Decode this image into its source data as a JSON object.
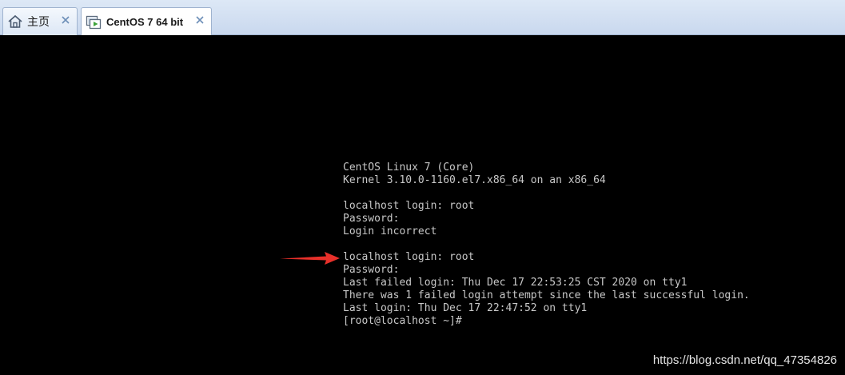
{
  "tabs": [
    {
      "label": "主页",
      "icon": "home-icon",
      "active": false
    },
    {
      "label": "CentOS 7 64 bit",
      "icon": "vm-icon",
      "active": true
    }
  ],
  "close_glyph": "✕",
  "terminal": {
    "lines": [
      "CentOS Linux 7 (Core)",
      "Kernel 3.10.0-1160.el7.x86_64 on an x86_64",
      "",
      "localhost login: root",
      "Password:",
      "Login incorrect",
      "",
      "localhost login: root",
      "Password:",
      "Last failed login: Thu Dec 17 22:53:25 CST 2020 on tty1",
      "There was 1 failed login attempt since the last successful login.",
      "Last login: Thu Dec 17 22:47:52 on tty1",
      "[root@localhost ~]#"
    ]
  },
  "annotation": {
    "icon": "arrow-right-icon",
    "color": "#e8302a"
  },
  "watermark": "https://blog.csdn.net/qq_47354826",
  "colors": {
    "console_bg": "#000000",
    "console_text": "#c8c8c8",
    "tabbar_bg": "#dde8f6",
    "close_color": "#3a6ea8"
  }
}
